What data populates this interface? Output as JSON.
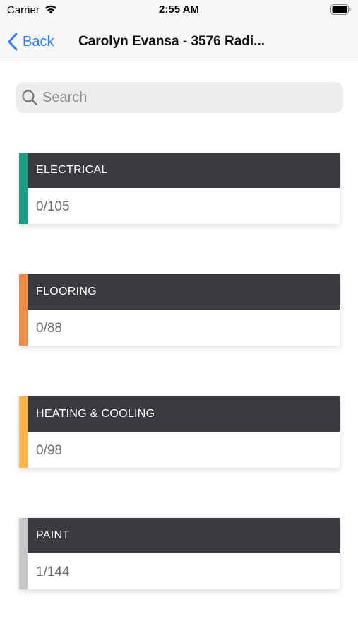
{
  "status_bar": {
    "carrier": "Carrier",
    "time": "2:55 AM"
  },
  "nav": {
    "back_label": "Back",
    "title": "Carolyn Evansa - 3576 Radi..."
  },
  "search": {
    "value": "",
    "placeholder": "Search"
  },
  "categories": [
    {
      "title": "ELECTRICAL",
      "progress": "0/105",
      "accent_color": "#1a9e86"
    },
    {
      "title": "FLOORING",
      "progress": "0/88",
      "accent_color": "#f08c4a"
    },
    {
      "title": "HEATING & COOLING",
      "progress": "0/98",
      "accent_color": "#f7b54c"
    },
    {
      "title": "PAINT",
      "progress": "1/144",
      "accent_color": "#c6c6c8"
    }
  ],
  "icons": {
    "wifi": "wifi-icon",
    "battery": "battery-icon",
    "back": "chevron-left-icon",
    "search": "search-icon"
  }
}
